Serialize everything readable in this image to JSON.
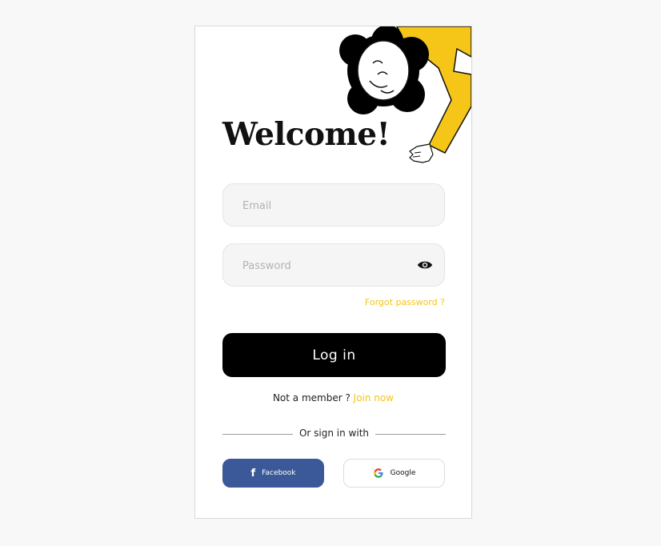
{
  "screen": {
    "title": "Welcome!"
  },
  "form": {
    "email_placeholder": "Email",
    "password_placeholder": "Password",
    "forgot_password": "Forgot password ?",
    "login_button": "Log in"
  },
  "signup": {
    "prompt": "Not a member ?",
    "link": "Join now"
  },
  "social": {
    "divider_label": "Or sign in with",
    "facebook_label": "Facebook",
    "google_label": "Google"
  },
  "colors": {
    "accent_yellow": "#f5c518",
    "facebook_blue": "#3b5998",
    "button_black": "#000000"
  },
  "icons": {
    "password_toggle": "eye-icon",
    "facebook": "facebook-icon",
    "google": "google-icon"
  }
}
